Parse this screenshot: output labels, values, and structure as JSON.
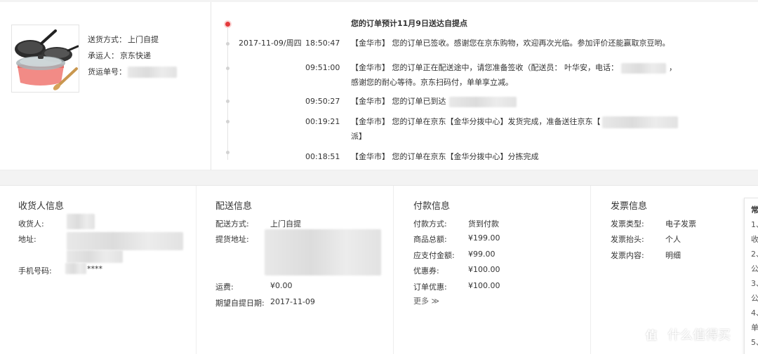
{
  "shipping": {
    "method_label": "送货方式：",
    "method_value": "上门自提",
    "carrier_label": "承运人：",
    "carrier_value": "京东快递",
    "waybill_label": "货运单号："
  },
  "tracking": {
    "title": "您的订单预计11月9日送达自提点",
    "entries": [
      {
        "date": "2017-11-09/周四",
        "time": "18:50:47",
        "msg": "【金华市】 您的订单已签收。感谢您在京东购物，欢迎再次光临。参加评价还能赢取京豆哟。"
      },
      {
        "date": "",
        "time": "09:51:00",
        "msg": "【金华市】 您的订单正在配送途中，请您准备签收（配送员： 叶华安，电话：",
        "msg_tail": "，",
        "msg2": "感谢您的耐心等待。京东扫码付，单单享立减。"
      },
      {
        "date": "",
        "time": "09:50:27",
        "msg": "【金华市】 您的订单已到达"
      },
      {
        "date": "",
        "time": "00:19:21",
        "msg": "【金华市】 您的订单在京东【金华分拨中心】发货完成，准备送往京东【",
        "msg2": "派】"
      },
      {
        "date": "",
        "time": "00:18:51",
        "msg": "【金华市】 您的订单在京东【金华分拨中心】分拣完成"
      }
    ]
  },
  "receiver": {
    "title": "收货人信息",
    "name_label": "收货人:",
    "address_label": "地址:",
    "phone_label": "手机号码:",
    "phone_value_suffix": "****"
  },
  "delivery": {
    "title": "配送信息",
    "method_label": "配送方式:",
    "method_value": "上门自提",
    "pickup_label": "提货地址:",
    "fee_label": "运费:",
    "fee_value": "¥0.00",
    "date_label": "期望自提日期:",
    "date_value": "2017-11-09"
  },
  "payment": {
    "title": "付款信息",
    "method_label": "付款方式:",
    "method_value": "货到付款",
    "total_label": "商品总额:",
    "total_value": "¥199.00",
    "due_label": "应支付金额:",
    "due_value": "¥99.00",
    "coupon_label": "优惠券:",
    "coupon_value": "¥100.00",
    "discount_label": "订单优惠:",
    "discount_value": "¥100.00",
    "more_label": "更多 ≫"
  },
  "invoice": {
    "title": "发票信息",
    "type_label": "发票类型:",
    "type_value": "电子发票",
    "header_label": "发票抬头:",
    "header_value": "个人",
    "content_label": "发票内容:",
    "content_value": "明细"
  },
  "side_card": {
    "title": "常",
    "lines": [
      "1、",
      "收",
      "2、",
      "公",
      "3、",
      "公",
      "4、",
      "单",
      "5、"
    ]
  },
  "watermark": {
    "icon": "值",
    "text": "什么值得买"
  },
  "colors": {
    "accent": "#e4393c",
    "text": "#333333",
    "line": "#e3e3e3"
  }
}
